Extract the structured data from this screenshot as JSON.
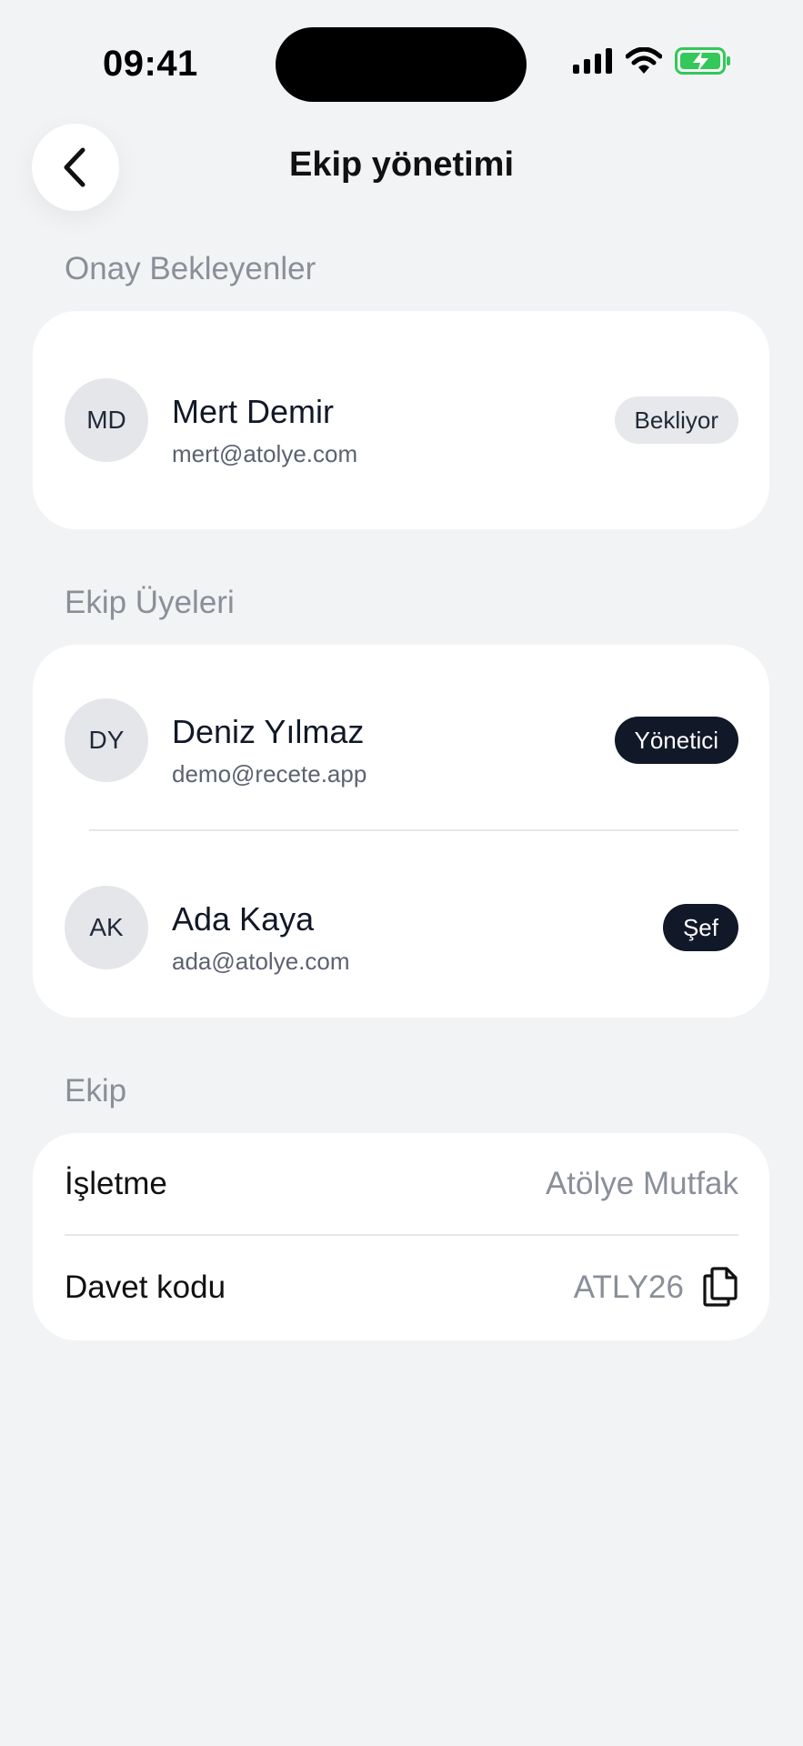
{
  "status_bar": {
    "time": "09:41"
  },
  "header": {
    "title": "Ekip yönetimi"
  },
  "pending": {
    "section_title": "Onay Bekleyenler",
    "items": [
      {
        "initials": "MD",
        "name": "Mert Demir",
        "email": "mert@atolye.com",
        "status": "Bekliyor"
      }
    ]
  },
  "members": {
    "section_title": "Ekip Üyeleri",
    "items": [
      {
        "initials": "DY",
        "name": "Deniz Yılmaz",
        "email": "demo@recete.app",
        "role": "Yönetici"
      },
      {
        "initials": "AK",
        "name": "Ada Kaya",
        "email": "ada@atolye.com",
        "role": "Şef"
      }
    ]
  },
  "team": {
    "section_title": "Ekip",
    "business_label": "İşletme",
    "business_value": "Atölye Mutfak",
    "invite_label": "Davet kodu",
    "invite_value": "ATLY26"
  },
  "colors": {
    "background": "#f2f3f5",
    "dark_badge": "#111827",
    "battery_green": "#34c759"
  },
  "icons": [
    "signal-icon",
    "wifi-icon",
    "battery-charging-icon",
    "chevron-left-icon",
    "copy-icon"
  ]
}
